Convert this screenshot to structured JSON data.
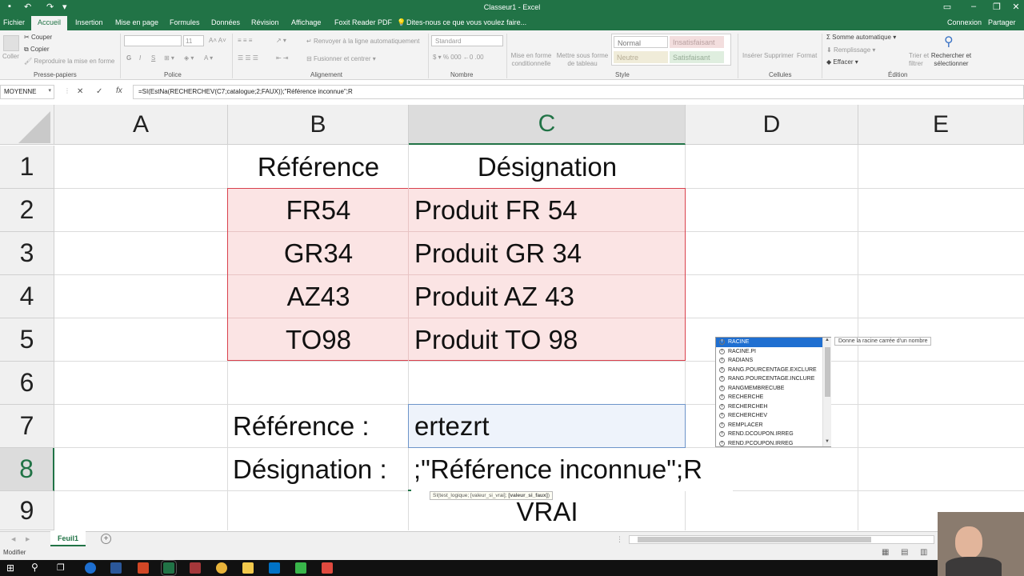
{
  "window": {
    "title": "Classeur1 - Excel",
    "share": "Partager",
    "signin": "Connexion"
  },
  "tabs": [
    "Fichier",
    "Accueil",
    "Insertion",
    "Mise en page",
    "Formules",
    "Données",
    "Révision",
    "Affichage",
    "Foxit Reader PDF"
  ],
  "tell_me": "Dites-nous ce que vous voulez faire...",
  "ribbon": {
    "clipboard": {
      "paste": "Coller",
      "cut": "Couper",
      "copy": "Copier",
      "format_painter": "Reproduire la mise en forme",
      "label": "Presse-papiers"
    },
    "font": {
      "label": "Police",
      "size": "11",
      "bold": "G",
      "italic": "I",
      "underline": "S"
    },
    "alignment": {
      "wrap": "Renvoyer à la ligne automatiquement",
      "merge": "Fusionner et centrer",
      "label": "Alignement"
    },
    "number": {
      "format": "Standard",
      "label": "Nombre"
    },
    "styles": {
      "cond_format": "Mise en forme conditionnelle",
      "table_format": "Mettre sous forme de tableau",
      "normal": "Normal",
      "bad": "Insatisfaisant",
      "neutral": "Neutre",
      "good": "Satisfaisant",
      "label": "Style"
    },
    "cells": {
      "insert": "Insérer",
      "delete": "Supprimer",
      "format": "Format",
      "label": "Cellules"
    },
    "editing": {
      "autosum": "Somme automatique",
      "fill": "Remplissage",
      "clear": "Effacer",
      "sort": "Trier et filtrer",
      "find": "Rechercher et sélectionner",
      "label": "Édition"
    }
  },
  "formula_bar": {
    "name_box": "MOYENNE",
    "formula": "=SI(EstNa(RECHERCHEV(C7;catalogue;2;FAUX));\"Référence inconnue\";R"
  },
  "columns": [
    "A",
    "B",
    "C",
    "D",
    "E"
  ],
  "rows": [
    "1",
    "2",
    "3",
    "4",
    "5",
    "6",
    "7",
    "8",
    "9"
  ],
  "cells": {
    "B1": "Référence",
    "C1": "Désignation",
    "B2": "FR54",
    "C2": "Produit FR 54",
    "B3": "GR34",
    "C3": "Produit GR 34",
    "B4": "AZ43",
    "C4": "Produit AZ 43",
    "B5": "TO98",
    "C5": "Produit TO 98",
    "B7": "Référence :",
    "C7": "ertezrt",
    "B8": "Désignation :",
    "C8": ";\"Référence inconnue\";R",
    "C9": "VRAI"
  },
  "autocomplete": {
    "items": [
      "RACINE",
      "RACINE.PI",
      "RADIANS",
      "RANG.POURCENTAGE.EXCLURE",
      "RANG.POURCENTAGE.INCLURE",
      "RANGMEMBRECUBE",
      "RECHERCHE",
      "RECHERCHEH",
      "RECHERCHEV",
      "REMPLACER",
      "REND.DCOUPON.IRREG",
      "REND.PCOUPON.IRREG"
    ],
    "tooltip": "Donne la racine carrée d'un nombre"
  },
  "arg_tip": {
    "func": "SI(test_logique; [valeur_si_vrai]; ",
    "bold": "[valeur_si_faux]",
    "close": ")"
  },
  "sheet_tab": "Feuil1",
  "status": "Modifier",
  "colors": {
    "excel_green": "#217346",
    "table_fill": "#fbe4e4",
    "table_border": "#d9414d",
    "input_fill": "#eef3fb",
    "selection": "#1f6fd1"
  }
}
